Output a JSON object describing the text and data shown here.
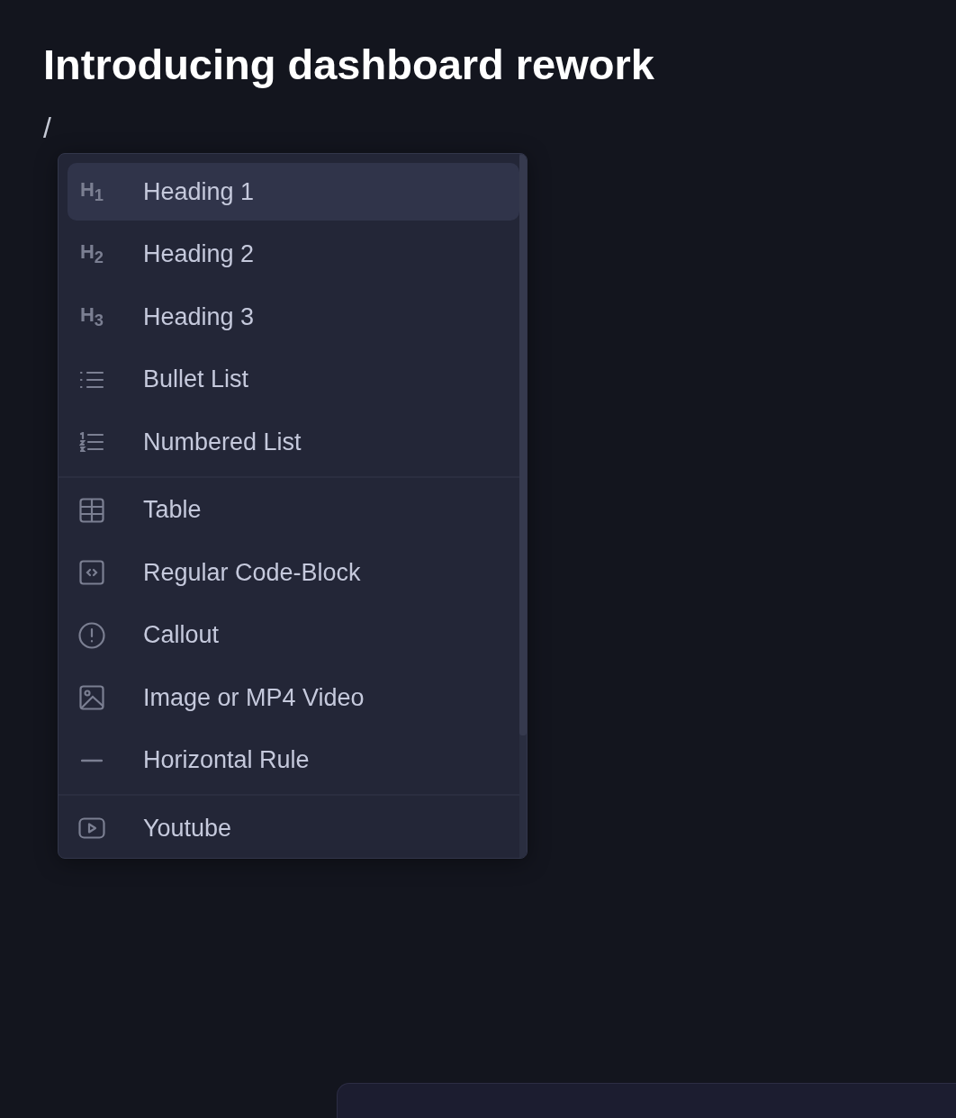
{
  "title": "Introducing dashboard rework",
  "editor_text": "/",
  "menu": {
    "sections": [
      {
        "items": [
          {
            "kind": "heading",
            "icon_text": "H$_{1}$",
            "label": "Heading 1",
            "selected": true
          },
          {
            "kind": "heading",
            "icon_text": "H$_{2}$",
            "label": "Heading 2",
            "selected": false
          },
          {
            "kind": "heading",
            "icon_text": "H$_{3}$",
            "label": "Heading 3",
            "selected": false
          },
          {
            "kind": "bullet",
            "label": "Bullet List",
            "selected": false
          },
          {
            "kind": "numbered",
            "label": "Numbered List",
            "selected": false
          }
        ]
      },
      {
        "items": [
          {
            "kind": "table",
            "label": "Table",
            "selected": false
          },
          {
            "kind": "code",
            "label": "Regular Code-Block",
            "selected": false
          },
          {
            "kind": "callout",
            "label": "Callout",
            "selected": false
          },
          {
            "kind": "image",
            "label": "Image or MP4 Video",
            "selected": false
          },
          {
            "kind": "rule",
            "label": "Horizontal Rule",
            "selected": false
          }
        ]
      },
      {
        "items": [
          {
            "kind": "video",
            "label": "Youtube",
            "selected": false
          }
        ]
      }
    ]
  }
}
